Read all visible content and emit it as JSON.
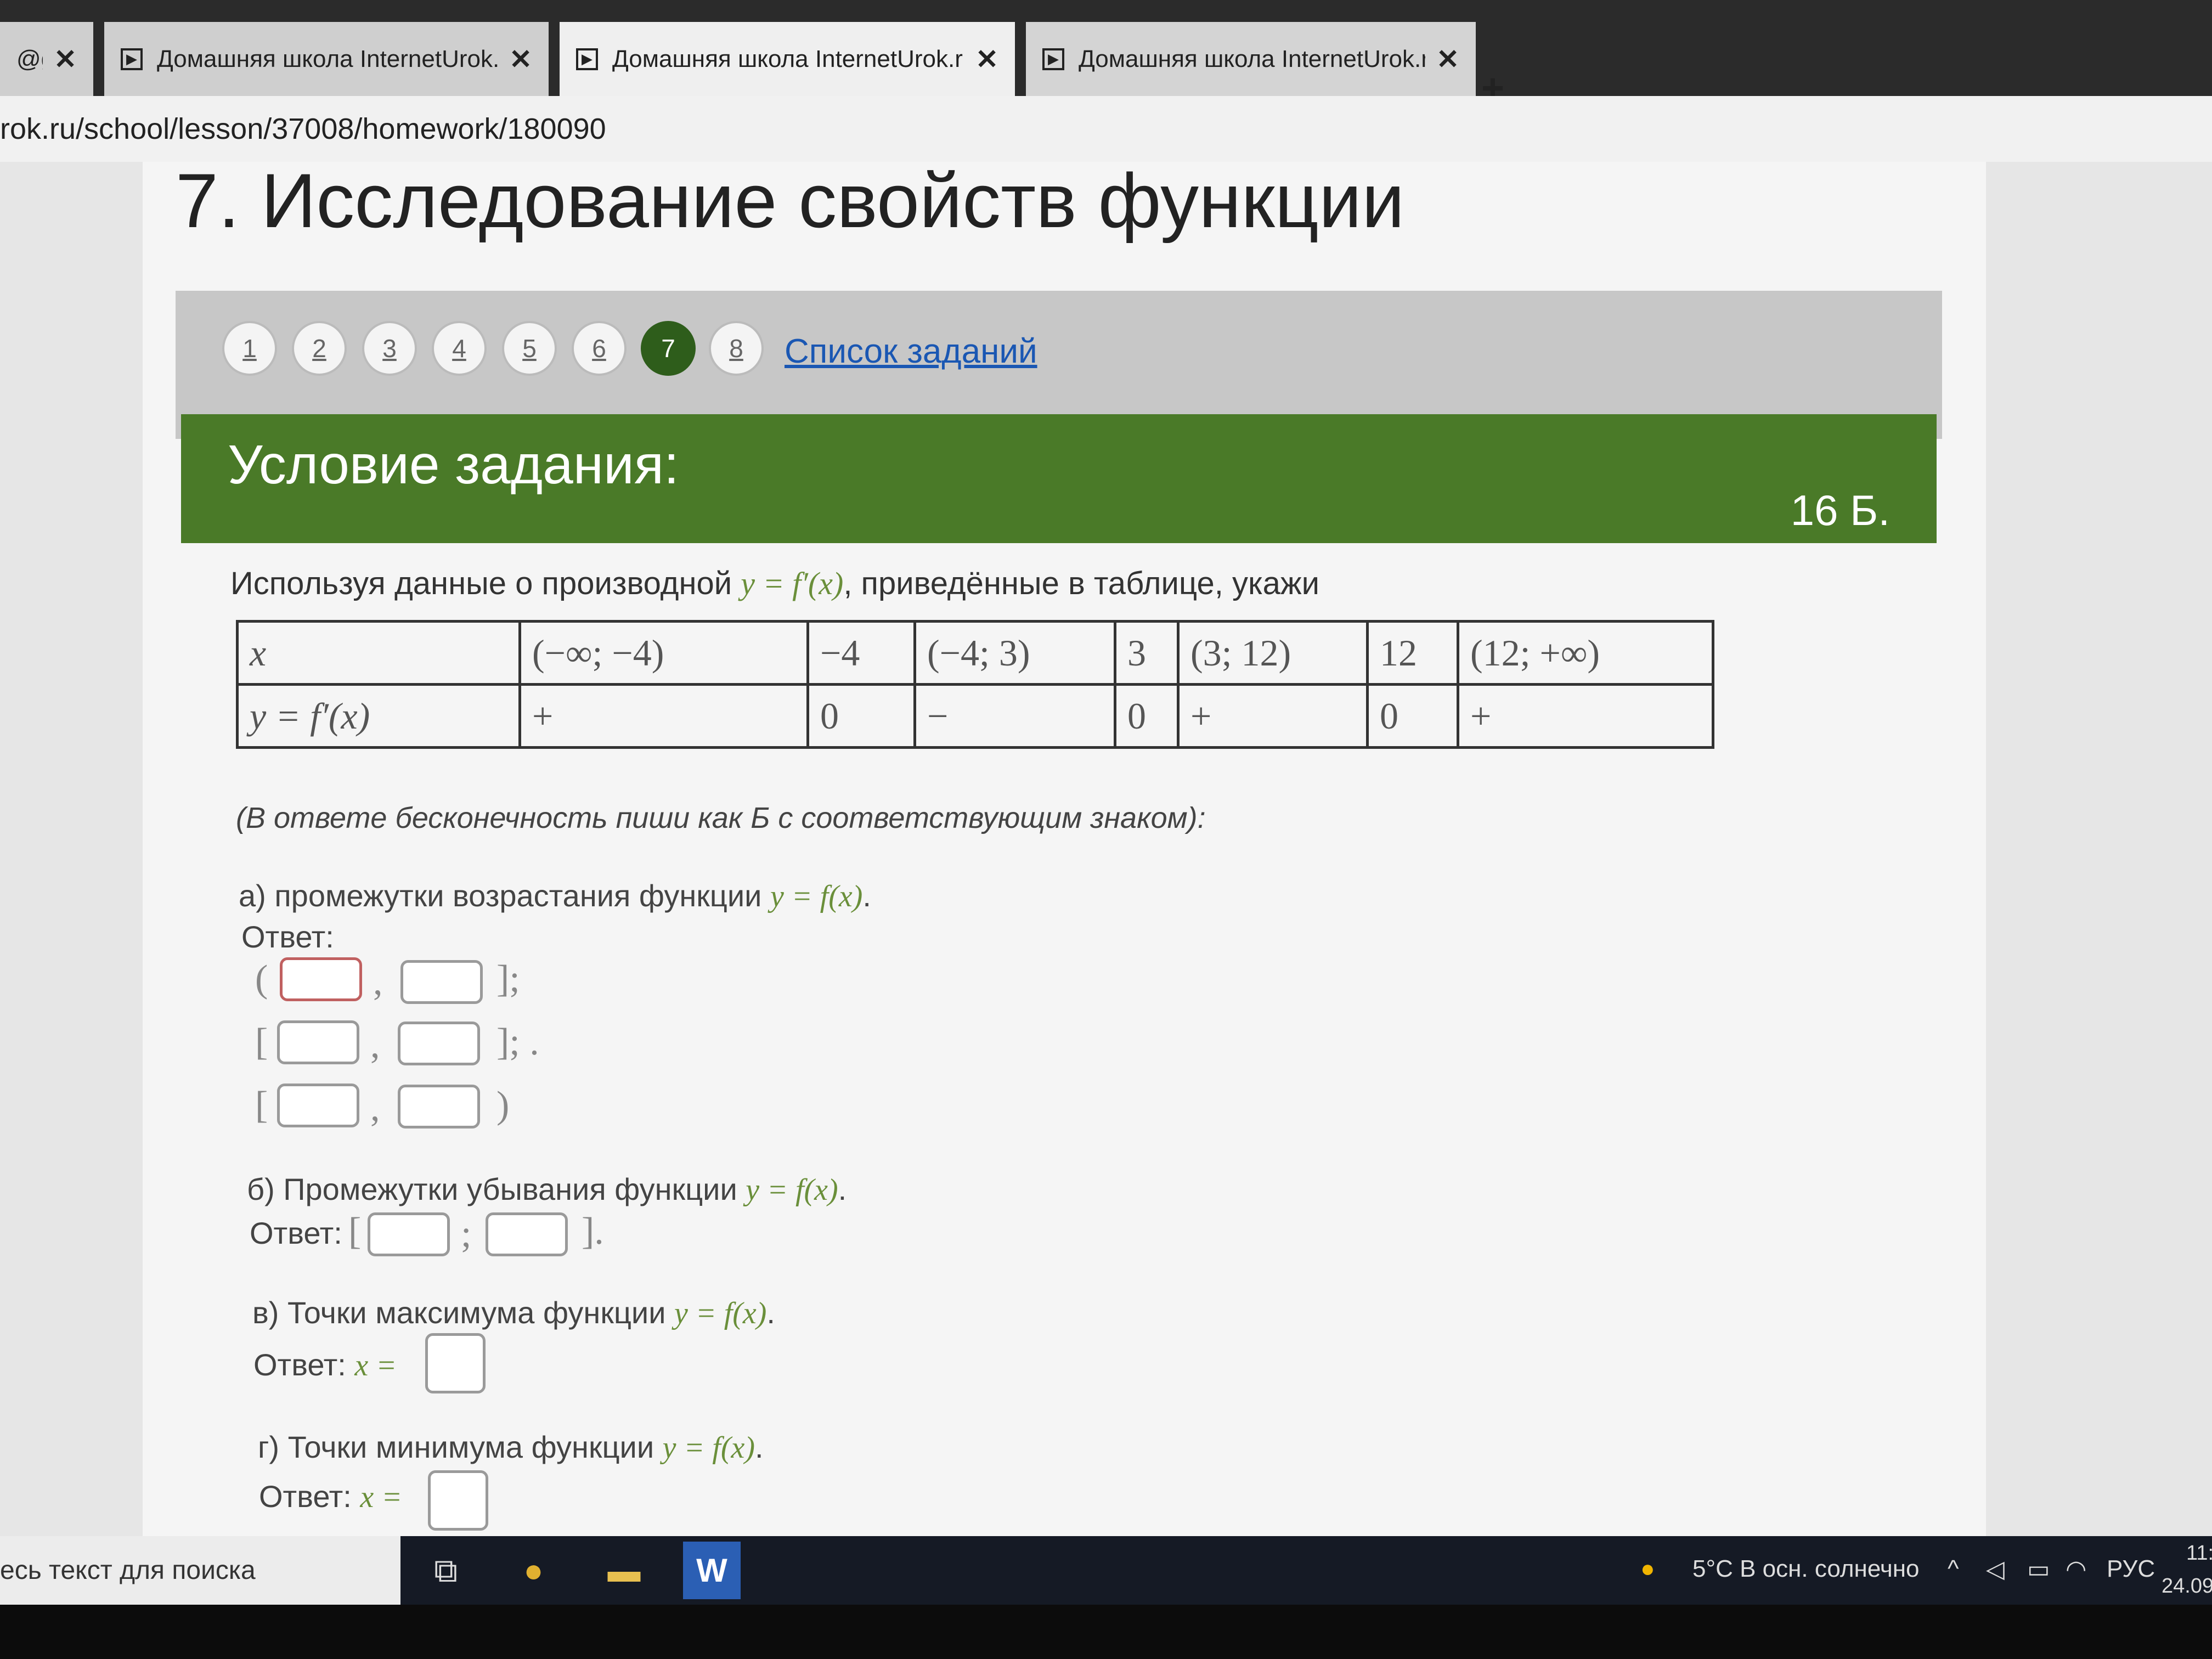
{
  "browser": {
    "tabs": [
      {
        "title": "@g",
        "active": false
      },
      {
        "title": "Домашняя школа InternetUrok.r",
        "active": false
      },
      {
        "title": "Домашняя школа InternetUrok.r",
        "active": true
      },
      {
        "title": "Домашняя школа InternetUrok.r",
        "active": false
      }
    ],
    "close_glyph": "✕",
    "new_tab": "+",
    "url": "rok.ru/school/lesson/37008/homework/180090"
  },
  "page": {
    "title": "7. Исследование свойств функции",
    "pager": {
      "items": [
        "1",
        "2",
        "3",
        "4",
        "5",
        "6",
        "7",
        "8"
      ],
      "active": "7",
      "list_link": "Список заданий"
    },
    "condition": {
      "header": "Условие задания:",
      "points": "16 Б."
    },
    "task_text_before": "Используя данные о производной ",
    "task_formula": "y = f′(x)",
    "task_text_after": ", приведённые в таблице, укажи",
    "table": {
      "row_x": [
        "x",
        "(−∞; −4)",
        "−4",
        "(−4; 3)",
        "3",
        "(3; 12)",
        "12",
        "(12; +∞)"
      ],
      "row_fprime": [
        "y = f′(x)",
        "+",
        "0",
        "−",
        "0",
        "+",
        "0",
        "+"
      ]
    },
    "note": "(В ответе бесконечность пиши как Б с соответствующим знаком):",
    "q_a": {
      "text": "а) промежутки возрастания функции ",
      "formula": "y = f(x)",
      "end": ".",
      "answer_label": "Ответ:"
    },
    "q_b": {
      "text": "б) Промежутки убывания функции ",
      "formula": "y = f(x)",
      "end": ".",
      "answer_label": "Ответ:"
    },
    "q_v": {
      "text": "в) Точки максимума функции ",
      "formula": "y = f(x)",
      "end": ".",
      "answer_label": "Ответ:",
      "var": "x ="
    },
    "q_g": {
      "text": "г) Точки минимума функции ",
      "formula": "y = f(x)",
      "end": ".",
      "answer_label": "Ответ:",
      "var": "x ="
    }
  },
  "taskbar": {
    "search_placeholder": "есь текст для поиска",
    "weather": "5°C В осн. солнечно",
    "lang": "РУС",
    "time": "11:",
    "date": "24.09."
  }
}
